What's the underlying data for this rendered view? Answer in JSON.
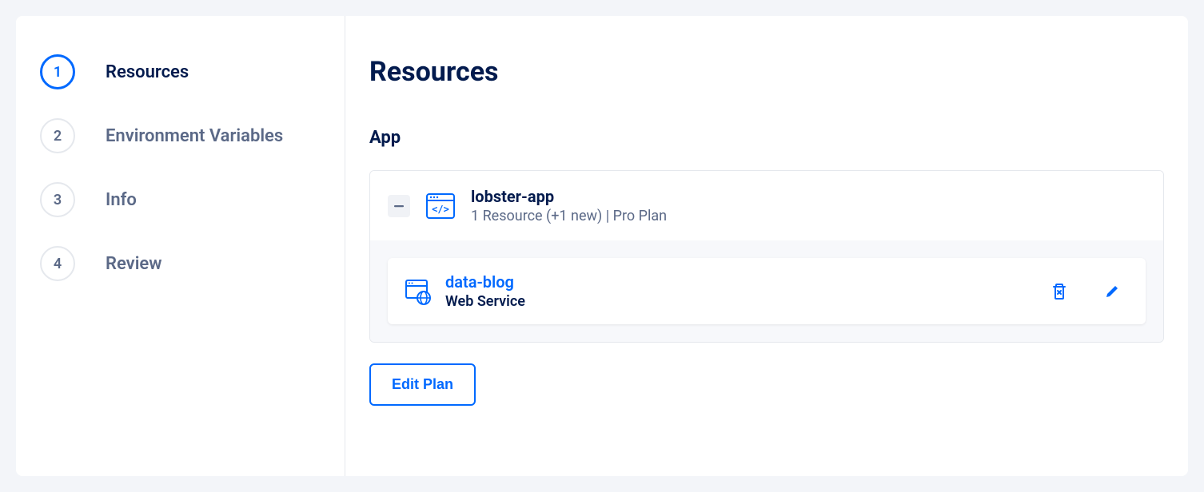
{
  "steps": [
    {
      "num": "1",
      "label": "Resources",
      "active": true
    },
    {
      "num": "2",
      "label": "Environment Variables",
      "active": false
    },
    {
      "num": "3",
      "label": "Info",
      "active": false
    },
    {
      "num": "4",
      "label": "Review",
      "active": false
    }
  ],
  "main": {
    "title": "Resources",
    "section": "App",
    "app": {
      "name": "lobster-app",
      "meta": "1 Resource (+1 new) | Pro Plan",
      "resources": [
        {
          "name": "data-blog",
          "type": "Web Service"
        }
      ]
    },
    "editPlanLabel": "Edit Plan"
  }
}
